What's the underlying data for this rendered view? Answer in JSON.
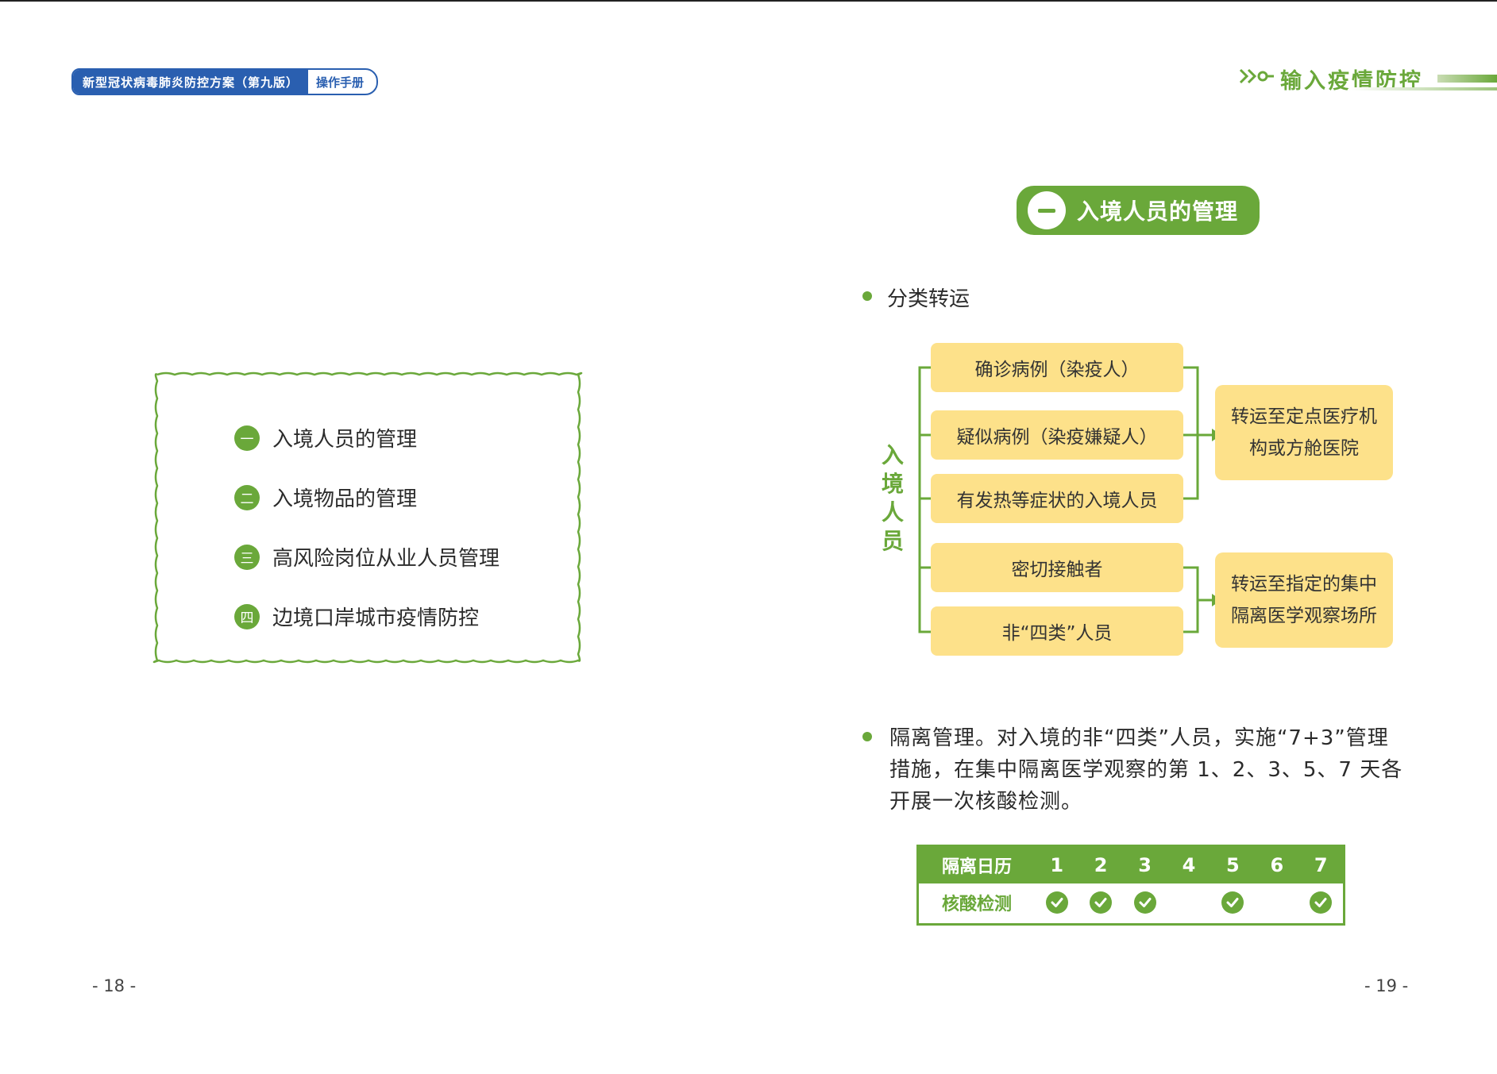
{
  "header": {
    "left_badge_main": "新型冠状病毒肺炎防控方案（第九版）",
    "left_badge_sub": "操作手册",
    "right_title": "输入疫情防控"
  },
  "contents": {
    "items": [
      {
        "num": "一",
        "label": "入境人员的管理"
      },
      {
        "num": "二",
        "label": "入境物品的管理"
      },
      {
        "num": "三",
        "label": "高风险岗位从业人员管理"
      },
      {
        "num": "四",
        "label": "边境口岸城市疫情防控"
      }
    ]
  },
  "section": {
    "title": "入境人员的管理"
  },
  "bullet1": "分类转运",
  "flow": {
    "vertical_label": "入\n境\n人\n员",
    "sources": [
      "确诊病例（染疫人）",
      "疑似病例（染疫嫌疑人）",
      "有发热等症状的入境人员",
      "密切接触者",
      "非“四类”人员"
    ],
    "targets": [
      "转运至定点医疗机构或方舱医院",
      "转运至指定的集中隔离医学观察场所"
    ]
  },
  "paragraph": "隔离管理。对入境的非“四类”人员，实施“7+3”管理措施，在集中隔离医学观察的第 1、2、3、5、7 天各开展一次核酸检测。",
  "calendar": {
    "header_label": "隔离日历",
    "days": [
      "1",
      "2",
      "3",
      "4",
      "5",
      "6",
      "7"
    ],
    "row_label": "核酸检测",
    "tested": [
      true,
      true,
      true,
      false,
      true,
      false,
      true
    ]
  },
  "page_numbers": {
    "left": "- 18 -",
    "right": "- 19 -"
  },
  "colors": {
    "accent_green": "#6aa83a",
    "box_yellow": "#fde18a",
    "badge_blue": "#2a5fb0"
  }
}
